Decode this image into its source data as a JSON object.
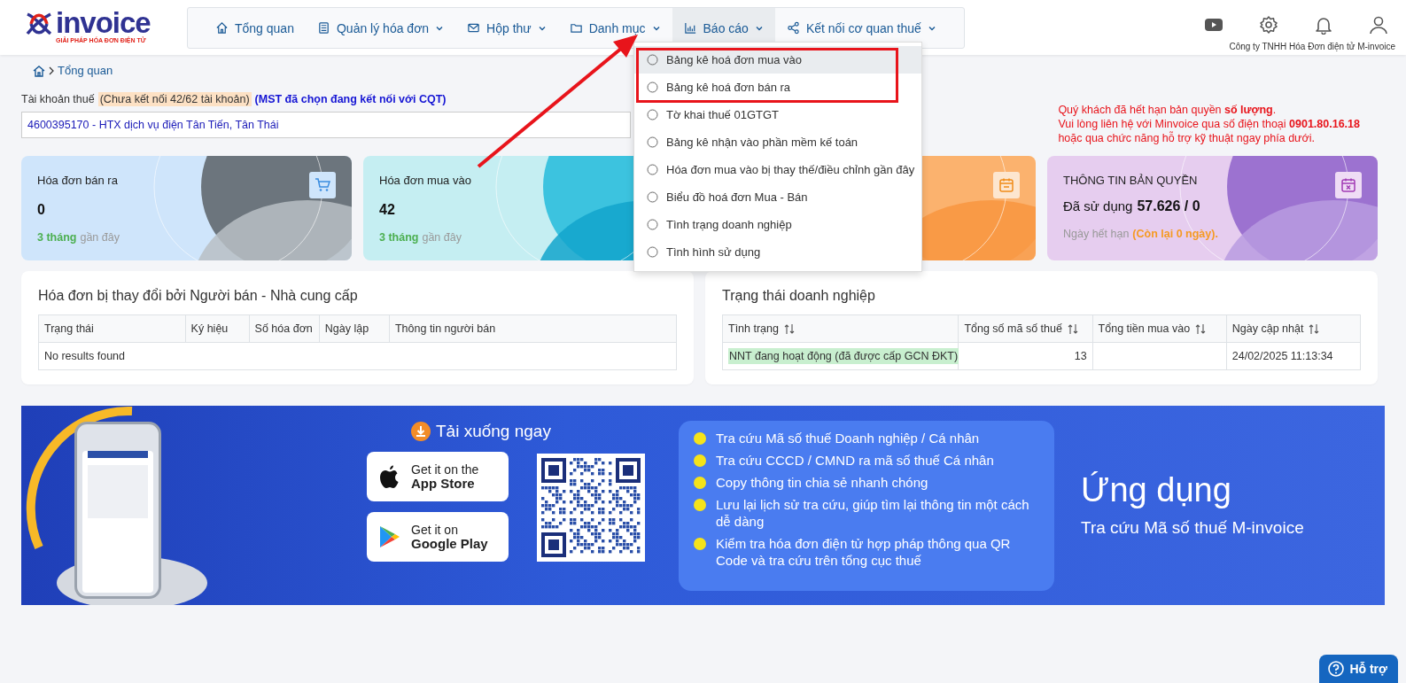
{
  "logo": {
    "name": "invoice",
    "tagline": "GIẢI PHÁP HÓA ĐƠN ĐIỆN TỬ"
  },
  "nav": {
    "items": [
      {
        "label": "Tổng quan",
        "has_dropdown": false,
        "selected": false
      },
      {
        "label": "Quản lý hóa đơn",
        "has_dropdown": true,
        "selected": false
      },
      {
        "label": "Hộp thư",
        "has_dropdown": true,
        "selected": false
      },
      {
        "label": "Danh mục",
        "has_dropdown": true,
        "selected": false
      },
      {
        "label": "Báo cáo",
        "has_dropdown": true,
        "selected": true
      },
      {
        "label": "Kết nối cơ quan thuế",
        "has_dropdown": true,
        "selected": false
      }
    ]
  },
  "company": "Công ty TNHH Hóa Đơn điện tử M-invoice",
  "report_menu": {
    "items": [
      {
        "label": "Bảng kê hoá đơn mua vào",
        "highlighted": true,
        "boxed": true
      },
      {
        "label": "Bảng kê hoá đơn bán ra",
        "highlighted": false,
        "boxed": true
      },
      {
        "label": "Tờ khai thuế 01GTGT",
        "highlighted": false,
        "boxed": false
      },
      {
        "label": "Bảng kê nhận vào phần mềm kế toán",
        "highlighted": false,
        "boxed": false
      },
      {
        "label": "Hóa đơn mua vào bị thay thế/điều chỉnh gần đây",
        "highlighted": false,
        "boxed": false
      },
      {
        "label": "Biểu đồ hoá đơn Mua - Bán",
        "highlighted": false,
        "boxed": false
      },
      {
        "label": "Tình trạng doanh nghiệp",
        "highlighted": false,
        "boxed": false
      },
      {
        "label": "Tình hình sử dụng",
        "highlighted": false,
        "boxed": false
      }
    ]
  },
  "breadcrumb": "Tổng quan",
  "tax_account": {
    "label": "Tài khoản thuế",
    "status": "(Chưa kết nối 42/62 tài khoản)",
    "note": "(MST đã chọn đang kết nối với CQT)",
    "value": "4600395170 - HTX dịch vụ điện Tân Tiến, Tân Thái"
  },
  "notice": [
    "Quý khách đã hết hạn bản quyền **số lượng**.",
    "Vui lòng liên hệ với Minvoice qua số điện thoại **0901.80.16.18**",
    "hoặc qua chức năng hỗ trợ kỹ thuật ngay phía dưới."
  ],
  "cards": [
    {
      "kind": "sales",
      "title": "Hóa đơn bán ra",
      "value": "0",
      "period": "3 tháng",
      "period_suffix": "gần đây"
    },
    {
      "kind": "purchase",
      "title": "Hóa đơn mua vào",
      "value": "42",
      "period": "3 tháng",
      "period_suffix": "gần đây"
    },
    {
      "kind": "orange"
    },
    {
      "kind": "license",
      "title": "THÔNG TIN BẢN QUYỀN",
      "value_label": "Đã sử dụng",
      "value": "57.626 / 0",
      "period_prefix": "Ngày hết hạn",
      "period": "(Còn lại 0 ngày)."
    }
  ],
  "changed_invoices": {
    "title": "Hóa đơn bị thay đổi bởi Người bán - Nhà cung cấp",
    "columns": [
      {
        "label": "Trạng thái"
      },
      {
        "label": "Ký hiệu"
      },
      {
        "label": "Số hóa đơn"
      },
      {
        "label": "Ngày lập"
      },
      {
        "label": "Thông tin người bán"
      }
    ],
    "empty": "No results found"
  },
  "business_status": {
    "title": "Trạng thái doanh nghiệp",
    "columns": [
      {
        "label": "Tình trạng",
        "sortable": true
      },
      {
        "label": "Tổng số mã số thuế",
        "sortable": true
      },
      {
        "label": "Tổng tiền mua vào",
        "sortable": true
      },
      {
        "label": "Ngày cập nhật",
        "sortable": true
      }
    ],
    "rows": [
      {
        "cells": [
          "NNT đang hoạt động (đã được cấp GCN ĐKT)",
          "13",
          "",
          "24/02/2025 11:13:34"
        ],
        "highlighted": true
      }
    ]
  },
  "banner": {
    "download_title": "Tải xuống ngay",
    "stores": [
      {
        "kind": "apple",
        "line1": "Get it on the",
        "line2": "App Store"
      },
      {
        "kind": "google",
        "line1": "Get it on",
        "line2": "Google Play"
      }
    ],
    "features": [
      "Tra cứu Mã số thuế Doanh nghiệp / Cá nhân",
      "Tra cứu CCCD / CMND ra mã số thuế Cá nhân",
      "Copy thông tin chia sẻ nhanh chóng",
      "Lưu lại lịch sử tra cứu, giúp tìm lại thông tin một cách dễ dàng",
      "Kiểm tra hóa đơn điện tử hợp pháp thông qua QR Code và tra cứu trên tổng cục thuế"
    ],
    "headline": "Ứng dụng",
    "subheadline": "Tra cứu Mã số thuế M-invoice"
  },
  "help_button": "Hỗ trợ"
}
